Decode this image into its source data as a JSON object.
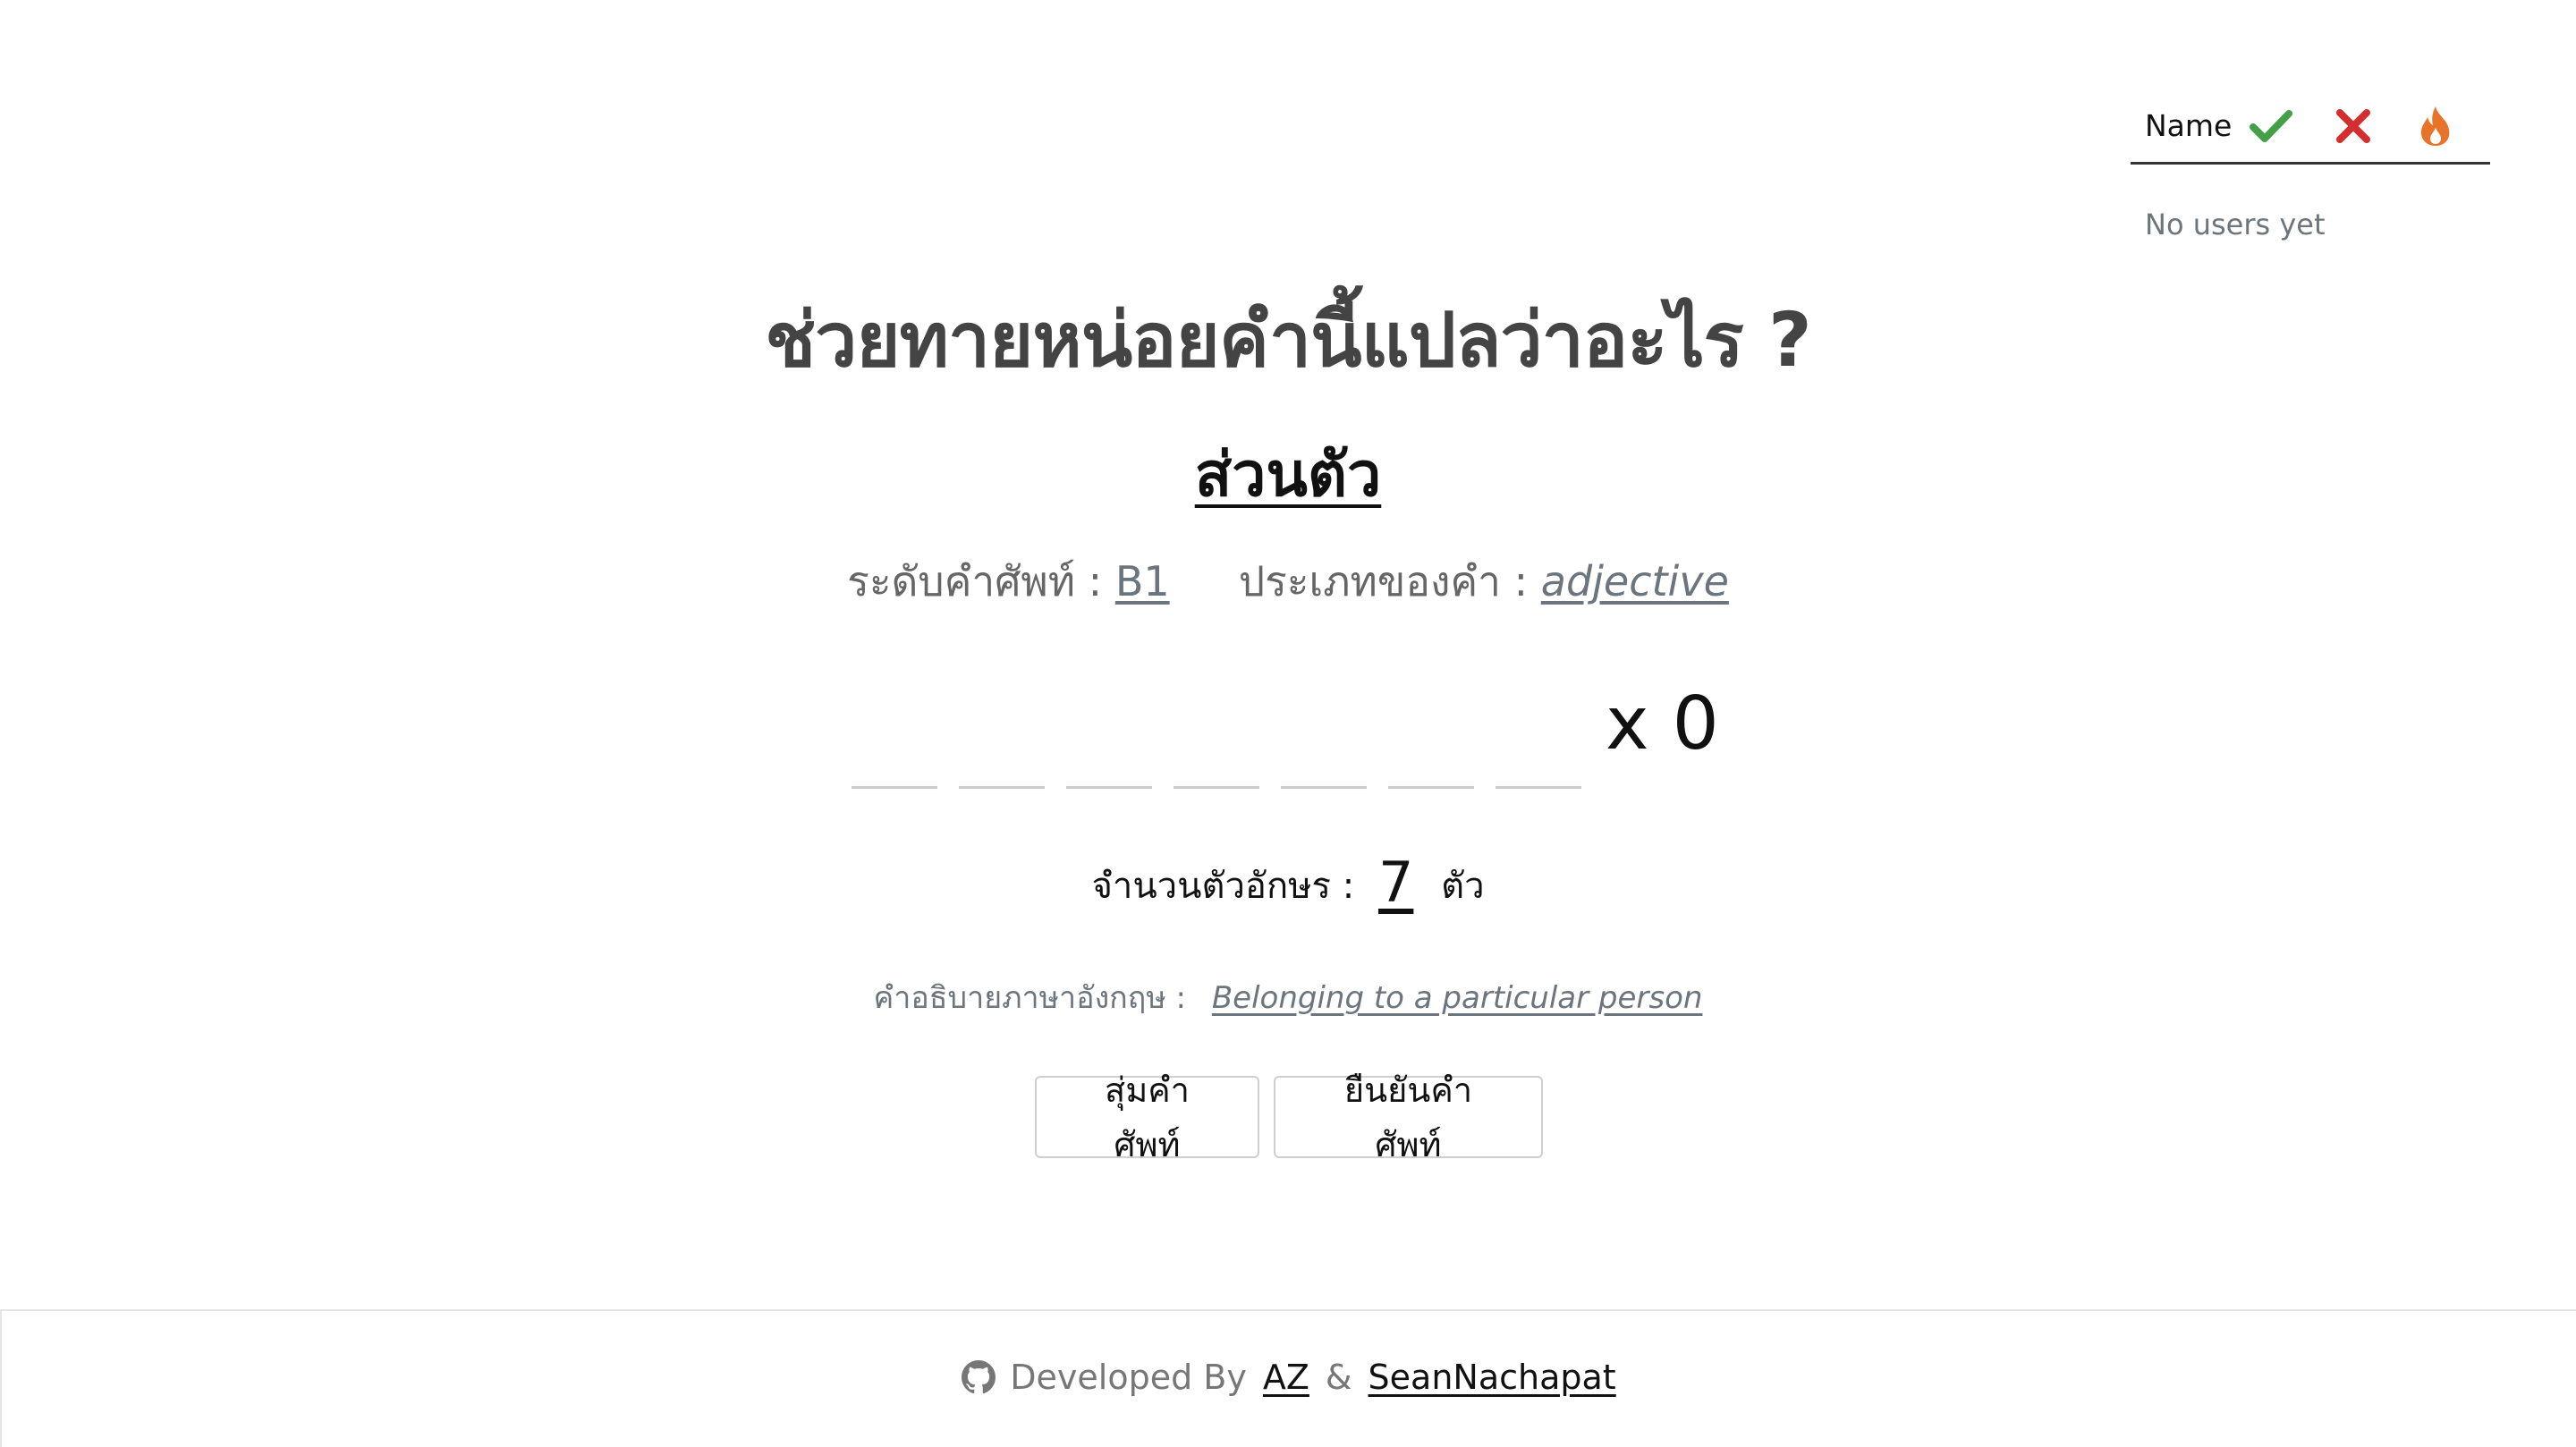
{
  "scoreboard": {
    "name_header": "Name",
    "correct_icon": "check-icon",
    "wrong_icon": "x-icon",
    "streak_icon": "fire-icon",
    "empty_text": "No users yet",
    "colors": {
      "correct": "#43a047",
      "wrong": "#d32f2f",
      "streak": "#e8732a"
    }
  },
  "game": {
    "title": "ช่วยทายหน่อยคำนี้แปลว่าอะไร ?",
    "thai_word": "ส่วนตัว",
    "level_label": "ระดับคำศัพท์ :",
    "level_value": "B1",
    "type_label": "ประเภทของคำ :",
    "type_value": "adjective",
    "letter_slots": 7,
    "multiplier": "x 0",
    "count_label": "จำนวนตัวอักษร :",
    "count_value": "7",
    "count_unit": "ตัว",
    "desc_label": "คำอธิบายภาษาอังกฤษ :",
    "desc_value": "Belonging to a particular person",
    "random_button": "สุ่มคำศัพท์",
    "confirm_button": "ยืนยันคำศัพท์"
  },
  "footer": {
    "github_icon": "github-icon",
    "developed_by": "Developed By",
    "author1": "AZ",
    "separator": "&",
    "author2": "SeanNachapat"
  }
}
